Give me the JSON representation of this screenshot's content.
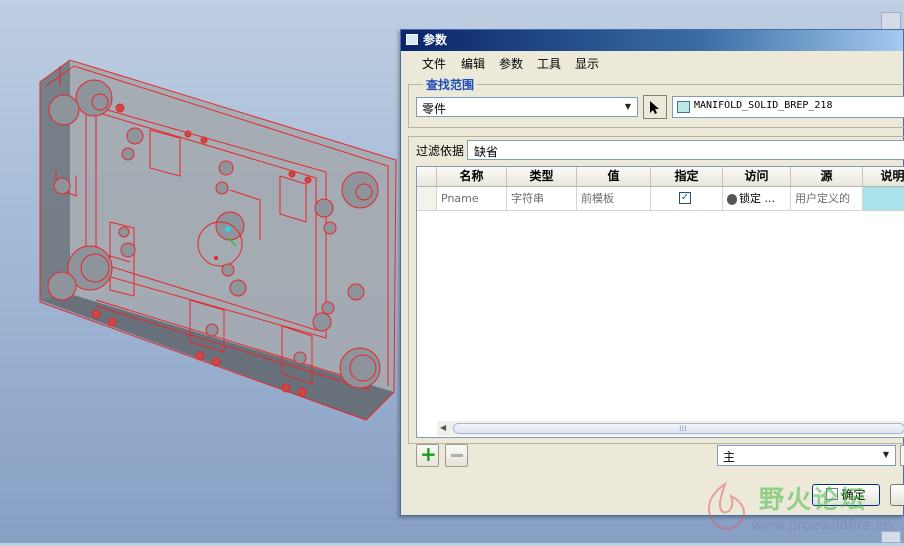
{
  "dialog": {
    "title": "参数",
    "menu": [
      "文件",
      "编辑",
      "参数",
      "工具",
      "显示"
    ],
    "scope": {
      "legend": "查找范围",
      "combo_value": "零件",
      "part_name": "MANIFOLD_SOLID_BREP_218"
    },
    "filter": {
      "label": "过滤依据",
      "value": "缺省"
    },
    "table": {
      "headers": [
        "名称",
        "类型",
        "值",
        "指定",
        "访问",
        "源",
        "说明"
      ],
      "rows": [
        {
          "name": "Pname",
          "type": "字符串",
          "value": "前模板",
          "designated": "✓",
          "access": "锁定 ...",
          "source": "用户定义的",
          "description": ""
        }
      ],
      "scroll_grip": "⁞⁞⁞"
    },
    "bottom": {
      "main_combo": "主",
      "add_symbol": "+",
      "ok_label": "确定"
    }
  },
  "watermark": {
    "cn": "野火论坛",
    "url": "www.proewildfire.cn"
  },
  "colors": {
    "titlebar": "#0a246a",
    "legend": "#1e4db5",
    "model_wire": "#e8262a"
  }
}
